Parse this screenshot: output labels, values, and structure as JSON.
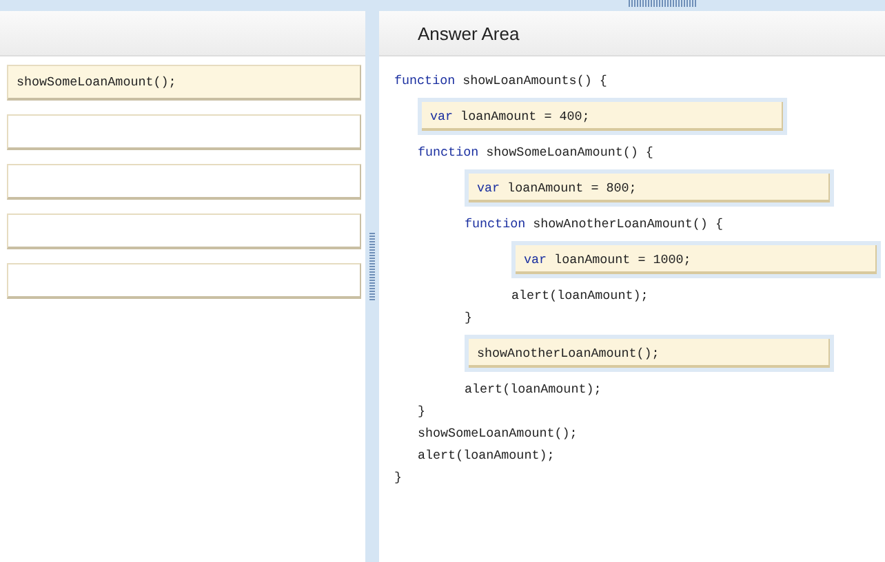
{
  "choices": [
    {
      "kind": "filled",
      "text": "showSomeLoanAmount();"
    },
    {
      "kind": "empty"
    },
    {
      "kind": "empty"
    },
    {
      "kind": "empty"
    },
    {
      "kind": "empty"
    }
  ],
  "answer_area": {
    "title": "Answer Area",
    "code": [
      {
        "kind": "line",
        "text": "function showLoanAmounts() {",
        "children": [
          {
            "kind": "drop",
            "text": "var loanAmount = 400;"
          },
          {
            "kind": "line",
            "text": "function showSomeLoanAmount() {",
            "children": [
              {
                "kind": "drop",
                "text": "var loanAmount = 800;"
              },
              {
                "kind": "line",
                "text": "function showAnotherLoanAmount() {",
                "children": [
                  {
                    "kind": "drop",
                    "text": "var loanAmount = 1000;"
                  },
                  {
                    "kind": "line",
                    "text": "alert(loanAmount);"
                  }
                ]
              },
              {
                "kind": "line",
                "text": "}"
              },
              {
                "kind": "drop",
                "text": "showAnotherLoanAmount();"
              },
              {
                "kind": "line",
                "text": "alert(loanAmount);"
              }
            ]
          },
          {
            "kind": "line",
            "text": "}"
          },
          {
            "kind": "line",
            "text": "showSomeLoanAmount();"
          },
          {
            "kind": "line",
            "text": "alert(loanAmount);"
          }
        ]
      },
      {
        "kind": "line",
        "text": "}"
      }
    ]
  }
}
